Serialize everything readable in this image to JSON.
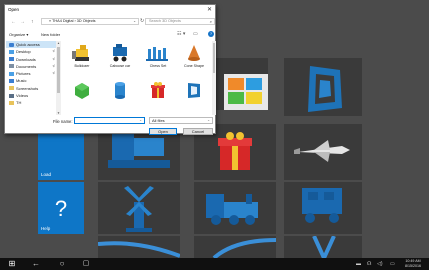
{
  "dialog": {
    "title": "Open",
    "close_glyph": "✕",
    "address": {
      "path": "« THA4 Digital › 3D Objects",
      "chevron": "⌄",
      "refresh": "↻"
    },
    "search_placeholder": "Search 3D Objects",
    "toolbar": {
      "organize": "Organize ▾",
      "new_folder": "New folder",
      "help": "?"
    },
    "nav": {
      "back": "←",
      "forward": "→",
      "up": "↑"
    },
    "sidebar": [
      {
        "label": "Quick access",
        "icon": "star-icon",
        "color": "#3b7fd1",
        "pinned": false,
        "selected": true
      },
      {
        "label": "Desktop",
        "icon": "desktop-icon",
        "color": "#4aa0e6",
        "pinned": true,
        "selected": false
      },
      {
        "label": "Downloads",
        "icon": "download-icon",
        "color": "#3b7fd1",
        "pinned": true,
        "selected": false
      },
      {
        "label": "Documents",
        "icon": "document-icon",
        "color": "#7d8fa3",
        "pinned": true,
        "selected": false
      },
      {
        "label": "Pictures",
        "icon": "picture-icon",
        "color": "#4aa0e6",
        "pinned": true,
        "selected": false
      },
      {
        "label": "Music",
        "icon": "music-icon",
        "color": "#3b7fd1",
        "pinned": false,
        "selected": false
      },
      {
        "label": "Screenshots",
        "icon": "folder-icon",
        "color": "#e8c35a",
        "pinned": false,
        "selected": false
      },
      {
        "label": "Videos",
        "icon": "video-icon",
        "color": "#5a6f86",
        "pinned": false,
        "selected": false
      },
      {
        "label": "TH",
        "icon": "folder-icon",
        "color": "#e8c35a",
        "pinned": false,
        "selected": false
      }
    ],
    "pin_glyph": "⊀",
    "files": [
      {
        "name": "Bulldozer",
        "icon": "bulldozer-icon"
      },
      {
        "name": "Caboose car",
        "icon": "caboose-icon"
      },
      {
        "name": "Chess Set",
        "icon": "chess-icon"
      },
      {
        "name": "Cone Shape",
        "icon": "cone-icon"
      },
      {
        "name": "",
        "icon": "cube-icon"
      },
      {
        "name": "",
        "icon": "cylinder-icon"
      },
      {
        "name": "",
        "icon": "gift-icon"
      },
      {
        "name": "",
        "icon": "frame-icon"
      }
    ],
    "file_name_label": "File name:",
    "file_name_value": "",
    "file_type": "All files",
    "open_label": "Open",
    "cancel_label": "Cancel"
  },
  "app": {
    "tiles": [
      {
        "label": "Load",
        "glyph": ""
      },
      {
        "label": "Help",
        "glyph": "?"
      }
    ]
  },
  "taskbar": {
    "start": "⊞",
    "back": "←",
    "search": "○",
    "taskview": "▢",
    "tray": [
      "▬",
      "☊",
      "◁)",
      "▭"
    ],
    "time": "10:49 AM",
    "date": "8/15/2016"
  },
  "colors": {
    "accent": "#0078d7",
    "tile_blue": "#0e76c7",
    "background": "#4b4b4b"
  }
}
